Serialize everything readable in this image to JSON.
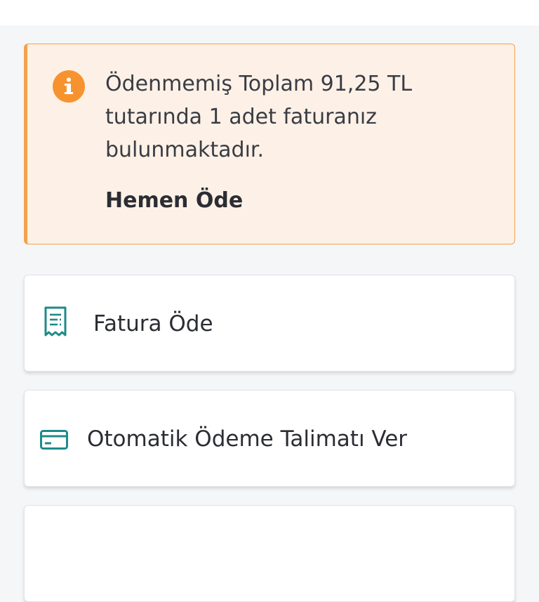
{
  "alert": {
    "icon": "info-icon",
    "message": "Ödenmemiş Toplam 91,25 TL tutarında 1 adet faturanız bulunmaktadır.",
    "action_label": "Hemen Öde",
    "accent_color": "#f4a24c",
    "background_color": "#fdf1e7"
  },
  "menu": {
    "items": [
      {
        "label": "Fatura Öde",
        "icon": "receipt-icon"
      },
      {
        "label": "Otomatik Ödeme Talimatı Ver",
        "icon": "credit-card-icon"
      },
      {
        "label": "",
        "icon": ""
      }
    ],
    "icon_color": "#1f8a8a"
  }
}
